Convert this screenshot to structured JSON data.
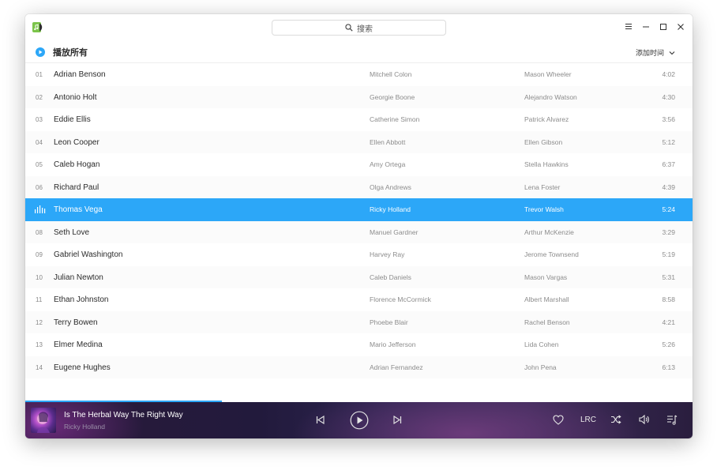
{
  "search": {
    "placeholder": "搜索"
  },
  "toolbar": {
    "play_all_label": "播放所有",
    "sort_label": "添加时间"
  },
  "tracks": [
    {
      "num": "01",
      "title": "Adrian Benson",
      "artist": "Mitchell Colon",
      "album": "Mason Wheeler",
      "duration": "4:02"
    },
    {
      "num": "02",
      "title": "Antonio Holt",
      "artist": "Georgie Boone",
      "album": "Alejandro Watson",
      "duration": "4:30"
    },
    {
      "num": "03",
      "title": "Eddie Ellis",
      "artist": "Catherine Simon",
      "album": "Patrick Alvarez",
      "duration": "3:56"
    },
    {
      "num": "04",
      "title": "Leon Cooper",
      "artist": "Ellen Abbott",
      "album": "Ellen Gibson",
      "duration": "5:12"
    },
    {
      "num": "05",
      "title": "Caleb Hogan",
      "artist": "Amy Ortega",
      "album": "Stella Hawkins",
      "duration": "6:37"
    },
    {
      "num": "06",
      "title": "Richard Paul",
      "artist": "Olga Andrews",
      "album": "Lena Foster",
      "duration": "4:39"
    },
    {
      "num": "",
      "title": "Thomas Vega",
      "artist": "Ricky Holland",
      "album": "Trevor Walsh",
      "duration": "5:24",
      "playing": true
    },
    {
      "num": "08",
      "title": "Seth Love",
      "artist": "Manuel Gardner",
      "album": "Arthur McKenzie",
      "duration": "3:29"
    },
    {
      "num": "09",
      "title": "Gabriel Washington",
      "artist": "Harvey Ray",
      "album": "Jerome Townsend",
      "duration": "5:19"
    },
    {
      "num": "10",
      "title": "Julian Newton",
      "artist": "Caleb Daniels",
      "album": "Mason Vargas",
      "duration": "5:31"
    },
    {
      "num": "11",
      "title": "Ethan Johnston",
      "artist": "Florence McCormick",
      "album": "Albert Marshall",
      "duration": "8:58"
    },
    {
      "num": "12",
      "title": "Terry Bowen",
      "artist": "Phoebe Blair",
      "album": "Rachel Benson",
      "duration": "4:21"
    },
    {
      "num": "13",
      "title": "Elmer Medina",
      "artist": "Mario Jefferson",
      "album": "Lida Cohen",
      "duration": "5:26"
    },
    {
      "num": "14",
      "title": "Eugene Hughes",
      "artist": "Adrian Fernandez",
      "album": "John Pena",
      "duration": "6:13"
    }
  ],
  "player": {
    "title": "Is The Herbal Way The Right Way",
    "artist": "Ricky Holland",
    "progress": 0.295,
    "lrc_label": "LRC"
  },
  "colors": {
    "accent": "#2ca7f8"
  },
  "icons": {
    "app": "music-app-icon",
    "search": "search-icon",
    "menu": "menu-icon",
    "minimize": "minimize-icon",
    "maximize": "maximize-icon",
    "close": "close-icon",
    "play_all": "play-circle-icon",
    "sort": "chevron-down-icon",
    "prev": "previous-icon",
    "play": "play-icon",
    "next": "next-icon",
    "favorite": "heart-icon",
    "shuffle": "shuffle-icon",
    "volume": "volume-icon",
    "playlist": "playlist-icon"
  }
}
